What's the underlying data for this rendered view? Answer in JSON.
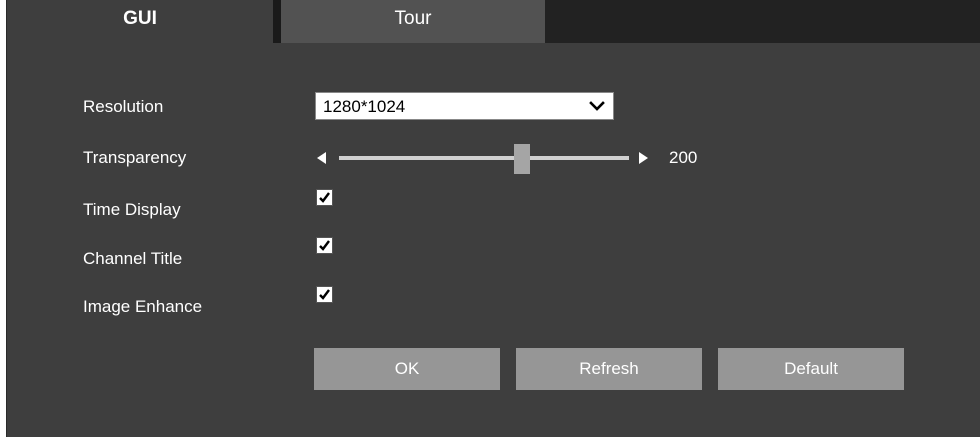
{
  "tabs": {
    "gui": "GUI",
    "tour": "Tour"
  },
  "fields": {
    "resolution": {
      "label": "Resolution",
      "value": "1280*1024"
    },
    "transparency": {
      "label": "Transparency",
      "value": "200",
      "level_fraction": 0.63
    },
    "time_display": {
      "label": "Time Display",
      "checked": true
    },
    "channel_title": {
      "label": "Channel Title",
      "checked": true
    },
    "image_enhance": {
      "label": "Image Enhance",
      "checked": true
    }
  },
  "buttons": {
    "ok": "OK",
    "refresh": "Refresh",
    "default": "Default"
  },
  "colors": {
    "panel_bg": "#3e3e3e",
    "tab_bar_bg": "#222222",
    "inactive_tab_bg": "#525252",
    "button_bg": "#969696",
    "text": "#ffffff"
  },
  "icons": {
    "dropdown": "chevron-down-icon",
    "check": "check-icon",
    "slider_decrease": "triangle-left-icon",
    "slider_increase": "triangle-right-icon"
  }
}
